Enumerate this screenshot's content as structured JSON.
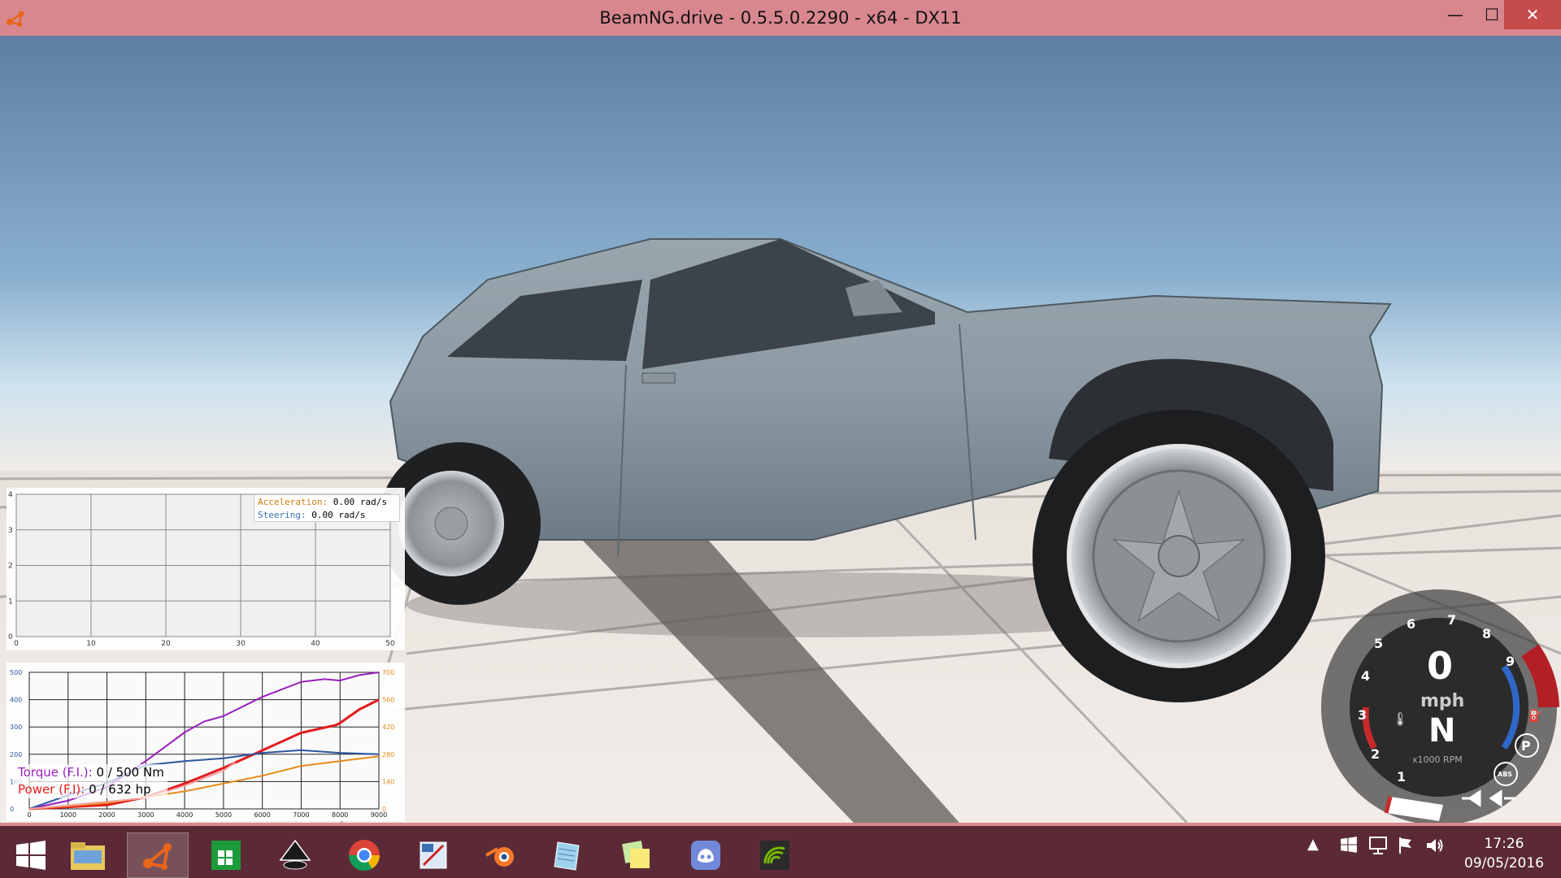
{
  "window": {
    "title": "BeamNG.drive - 0.5.5.0.2290 - x64 - DX11",
    "minimize_glyph": "—",
    "maximize_glyph": "☐",
    "close_glyph": "✕"
  },
  "app_debug": {
    "acceleration_label": "Acceleration:",
    "acceleration_value": "0.00 rad/s",
    "steering_label": "Steering:",
    "steering_value": "0.00 rad/s",
    "accel_color": "#d07a10",
    "steer_color": "#3a6fb0"
  },
  "chart_data": [
    {
      "type": "line",
      "title": "",
      "xlim": [
        0,
        50
      ],
      "ylim": [
        0,
        4
      ],
      "x_ticks": [
        "0",
        "10",
        "20",
        "30",
        "40",
        "50"
      ],
      "y_ticks": [
        "0",
        "1",
        "2",
        "3",
        "4"
      ],
      "series": []
    },
    {
      "type": "line",
      "xlabel": "",
      "x_ticks": [
        "0",
        "1000",
        "2000",
        "3000",
        "4000",
        "5000",
        "6000",
        "7000",
        "8000",
        "9000"
      ],
      "y_left_ticks": [
        "0",
        "100",
        "200",
        "300",
        "400",
        "500"
      ],
      "y_right_ticks": [
        "0",
        "140",
        "280",
        "420",
        "560",
        "700"
      ],
      "xlim": [
        0,
        9000
      ],
      "ylim_left": [
        0,
        500
      ],
      "ylim_right": [
        0,
        700
      ],
      "series": [
        {
          "color": "#9b1fbf",
          "axis": "left",
          "x": [
            0,
            1000,
            2000,
            3000,
            4000,
            4500,
            5000,
            6000,
            7000,
            7600,
            8000,
            8500,
            9000
          ],
          "y": [
            0,
            30,
            80,
            175,
            280,
            320,
            340,
            410,
            465,
            475,
            470,
            490,
            500
          ]
        },
        {
          "color": "#e31c1c",
          "axis": "right",
          "x": [
            0,
            2000,
            3000,
            4000,
            5000,
            6000,
            7000,
            7900,
            8000,
            8500,
            9000
          ],
          "y": [
            0,
            20,
            60,
            130,
            210,
            300,
            390,
            430,
            440,
            510,
            560
          ]
        },
        {
          "color": "#2a55a0",
          "axis": "left",
          "x": [
            0,
            1000,
            2000,
            3000,
            4000,
            5000,
            6000,
            7000,
            8000,
            9000
          ],
          "y": [
            0,
            50,
            95,
            160,
            175,
            185,
            205,
            215,
            205,
            200
          ]
        },
        {
          "color": "#e68a1a",
          "axis": "right",
          "x": [
            0,
            2000,
            3000,
            4000,
            5000,
            6000,
            7000,
            8000,
            9000
          ],
          "y": [
            0,
            30,
            60,
            90,
            130,
            170,
            220,
            245,
            270
          ]
        },
        {
          "color": "#f4a3a3",
          "axis": "left",
          "x": [
            0,
            3000,
            4000,
            5000,
            5300
          ],
          "y": [
            0,
            40,
            85,
            140,
            170
          ]
        }
      ]
    }
  ],
  "torque_power": {
    "torque_label": "Torque (F.I.):",
    "torque_value": "0 / 500 Nm",
    "power_label": "Power (F.I):",
    "power_value": "0 / 632 hp",
    "torque_color": "#9b1fbf",
    "power_color": "#e31c1c"
  },
  "gauge": {
    "speed": "0",
    "unit": "mph",
    "gear": "N",
    "rpm_label": "x1000 RPM",
    "rpm_marks": [
      "1",
      "2",
      "3",
      "4",
      "5",
      "6",
      "7",
      "8",
      "9"
    ],
    "park_label": "P",
    "abs_label": "ABS",
    "redline_color": "#b21f24",
    "temp_color": "#c8292a",
    "fuel_color": "#2f67c7"
  },
  "taskbar": {
    "apps": [
      {
        "name": "windows-start",
        "icon": "windows-logo-icon"
      },
      {
        "name": "file-explorer",
        "icon": "folder-icon"
      },
      {
        "name": "beamng",
        "icon": "beamng-icon",
        "active": true
      },
      {
        "name": "store",
        "icon": "store-icon"
      },
      {
        "name": "inkscape",
        "icon": "inkscape-icon"
      },
      {
        "name": "chrome",
        "icon": "chrome-icon"
      },
      {
        "name": "paint",
        "icon": "paint-icon"
      },
      {
        "name": "blender",
        "icon": "blender-icon"
      },
      {
        "name": "notepad",
        "icon": "notepad-icon"
      },
      {
        "name": "sticky-notes",
        "icon": "sticky-notes-icon"
      },
      {
        "name": "discord",
        "icon": "discord-icon"
      },
      {
        "name": "geforce",
        "icon": "wifi-app-icon"
      }
    ],
    "time": "17:26",
    "date": "09/05/2016"
  }
}
